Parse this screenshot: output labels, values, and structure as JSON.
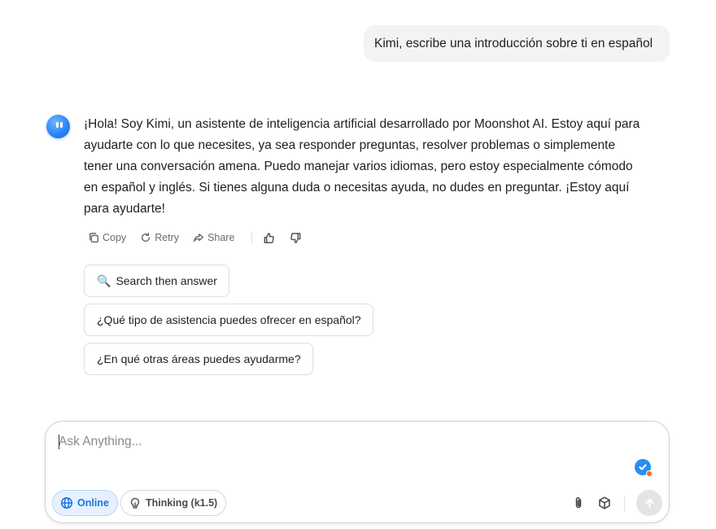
{
  "conversation": {
    "user_message": "Kimi, escribe una introducción sobre ti en español",
    "assistant_lines": [
      "¡Hola! Soy Kimi, un asistente de inteligencia artificial desarrollado por Moonshot AI. Estoy aquí para",
      "ayudarte con lo que necesites, ya sea responder preguntas, resolver problemas o simplemente",
      "tener una conversación amena. Puedo manejar varios idiomas, pero estoy especialmente cómodo",
      "en español y inglés. Si tienes alguna duda o necesitas ayuda, no dudes en preguntar. ¡Estoy aquí",
      "para ayudarte!"
    ]
  },
  "actions": {
    "copy": "Copy",
    "retry": "Retry",
    "share": "Share",
    "like_icon": "thumbs-up-icon",
    "dislike_icon": "thumbs-down-icon"
  },
  "suggestions": [
    {
      "icon": "🔍",
      "label": "Search then answer"
    },
    {
      "label": "¿Qué tipo de asistencia puedes ofrecer en español?"
    },
    {
      "label": "¿En qué otras áreas puedes ayudarme?"
    }
  ],
  "composer": {
    "placeholder": "Ask Anything...",
    "online_label": "Online",
    "thinking_label": "Thinking (k1.5)",
    "online_color": "#1a74e4",
    "badge_color": "#2a8cf0",
    "badge_dot_color": "#ff6a1a"
  }
}
